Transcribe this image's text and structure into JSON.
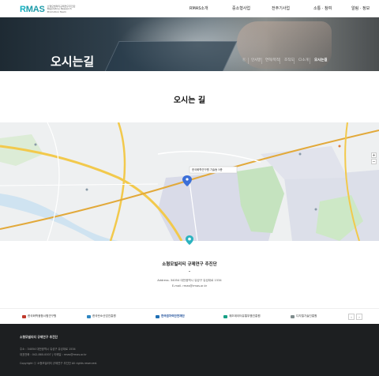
{
  "header": {
    "logo_text_main": "MAS",
    "logo_text_r": "R",
    "logo_sub": "소형모빌리티규제연구추진단 Regulatory Research Promotion Team",
    "nav": [
      "RMAS소개",
      "중소형사업",
      "전주기사업",
      "소통 · 참여",
      "알림 · 정보"
    ]
  },
  "hero": {
    "title": "오시는길",
    "breadcrumb": [
      "ⓗ",
      "인사말",
      "연혁/목적",
      "조직도",
      "CI소개",
      "오시는길"
    ]
  },
  "section": {
    "title": "오시는 길"
  },
  "map": {
    "callout": "한국화학연구원 기술동 5층",
    "controls": [
      "+",
      "−"
    ],
    "colors": {
      "road": "#f2c94c",
      "road_dark": "#e2a93a",
      "green": "#c5e3bf",
      "urban": "#d9dbe8",
      "water": "#b8d8ee"
    }
  },
  "info": {
    "name": "소형모빌리티 규제연구 추진단",
    "address": "Address. 34054 대전광역시 유성구 유성대로 1534",
    "email": "E-mail. rmas@rmas.or.kr"
  },
  "partners": {
    "items": [
      "한국화학융합시험연구원",
      "한국탄소산업진흥원",
      "한국원자력안전재단",
      "제조데이터유통부품진흥원",
      "디지털기술진흥원"
    ],
    "prev": "‹",
    "next": "›"
  },
  "footer": {
    "title": "소형모빌리티 규제연구 추진단",
    "address": "주소 : 34054 대전광역시 유성구 유성대로 1534",
    "contact": "대표전화 : 042-860-0007 | 이메일 : rmas@rmas.or.kr",
    "copyright": "Copyright ⓒ 소형모빌리티 규제연구 추진단 All rights reserved."
  }
}
